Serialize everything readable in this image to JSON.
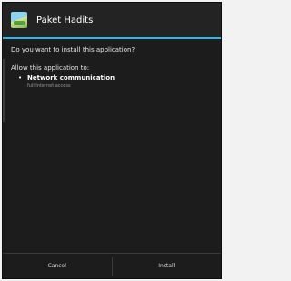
{
  "header": {
    "app_name": "Paket Hadits",
    "icon": "app-landscape-icon"
  },
  "content": {
    "question": "Do you want to install this application?",
    "allow_label": "Allow this application to:",
    "permissions": [
      {
        "bullet": "•",
        "title": "Network communication",
        "description": "full Internet access"
      }
    ]
  },
  "buttons": {
    "cancel_label": "Cancel",
    "install_label": "Install"
  },
  "colors": {
    "accent": "#33b5e5",
    "background": "#1c1c1c"
  }
}
